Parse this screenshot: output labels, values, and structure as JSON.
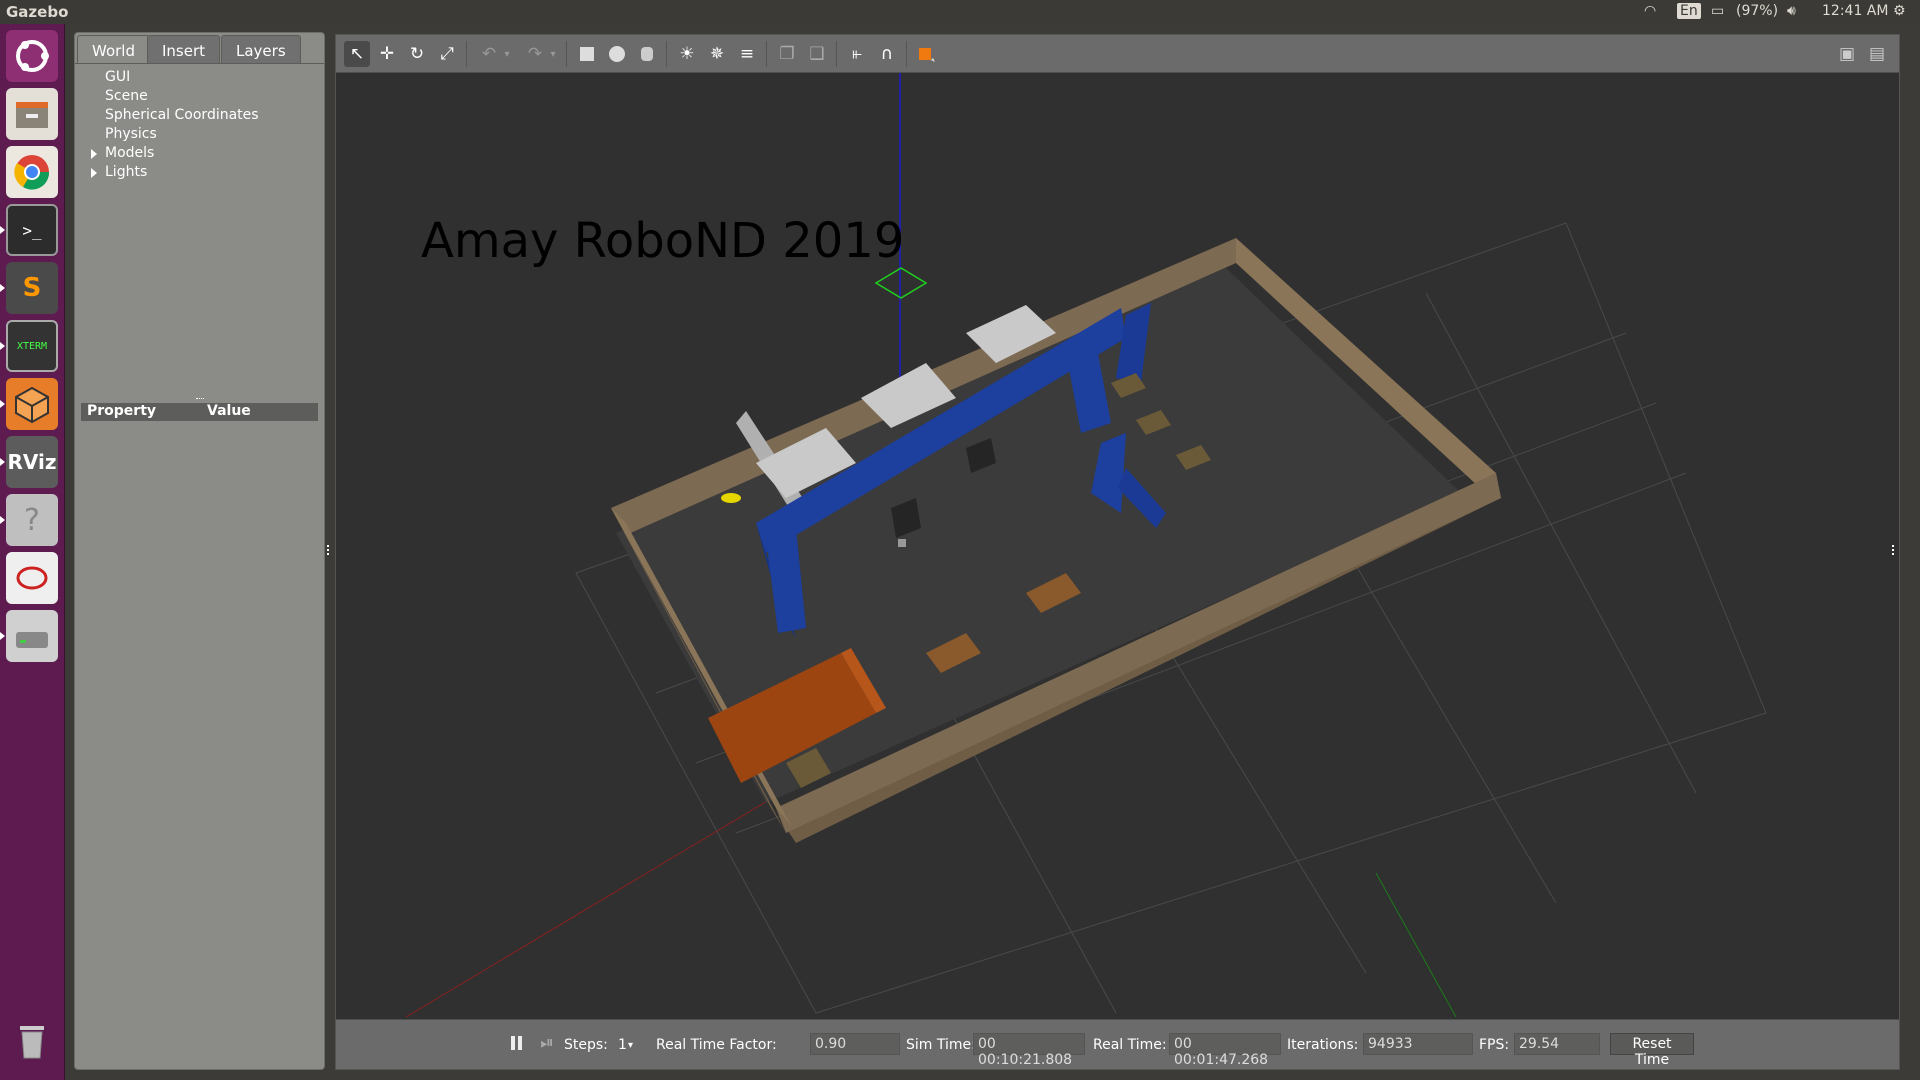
{
  "topbar": {
    "app_title": "Gazebo",
    "keyboard": "En",
    "battery": "(97%)",
    "time": "12:41 AM"
  },
  "launcher": {
    "items": [
      "ubuntu-home",
      "files",
      "chrome",
      "terminal",
      "sublime-text",
      "xterm",
      "gazebo",
      "rviz",
      "help",
      "ebook-viewer",
      "disk-drive",
      "trash"
    ]
  },
  "panel": {
    "tabs": [
      "World",
      "Insert",
      "Layers"
    ],
    "tree": [
      "GUI",
      "Scene",
      "Spherical Coordinates",
      "Physics",
      "Models",
      "Lights"
    ],
    "property_header": "Property",
    "value_header": "Value"
  },
  "viewport": {
    "overlay_text": "Amay RoboND 2019"
  },
  "status": {
    "steps_label": "Steps:",
    "steps_value": "1",
    "rtf_label": "Real Time Factor:",
    "rtf_value": "0.90",
    "sim_label": "Sim Time:",
    "sim_value": "00 00:10:21.808",
    "real_label": "Real Time:",
    "real_value": "00 00:01:47.268",
    "iter_label": "Iterations:",
    "iter_value": "94933",
    "fps_label": "FPS:",
    "fps_value": "29.54",
    "reset_label": "Reset Time"
  },
  "colors": {
    "launcher": "#5d1b4f",
    "wall_outer": "#7d6a52",
    "wall_blue": "#1b3fa0",
    "wall_orange": "#a14a10",
    "floor": "#3a3a3a"
  }
}
